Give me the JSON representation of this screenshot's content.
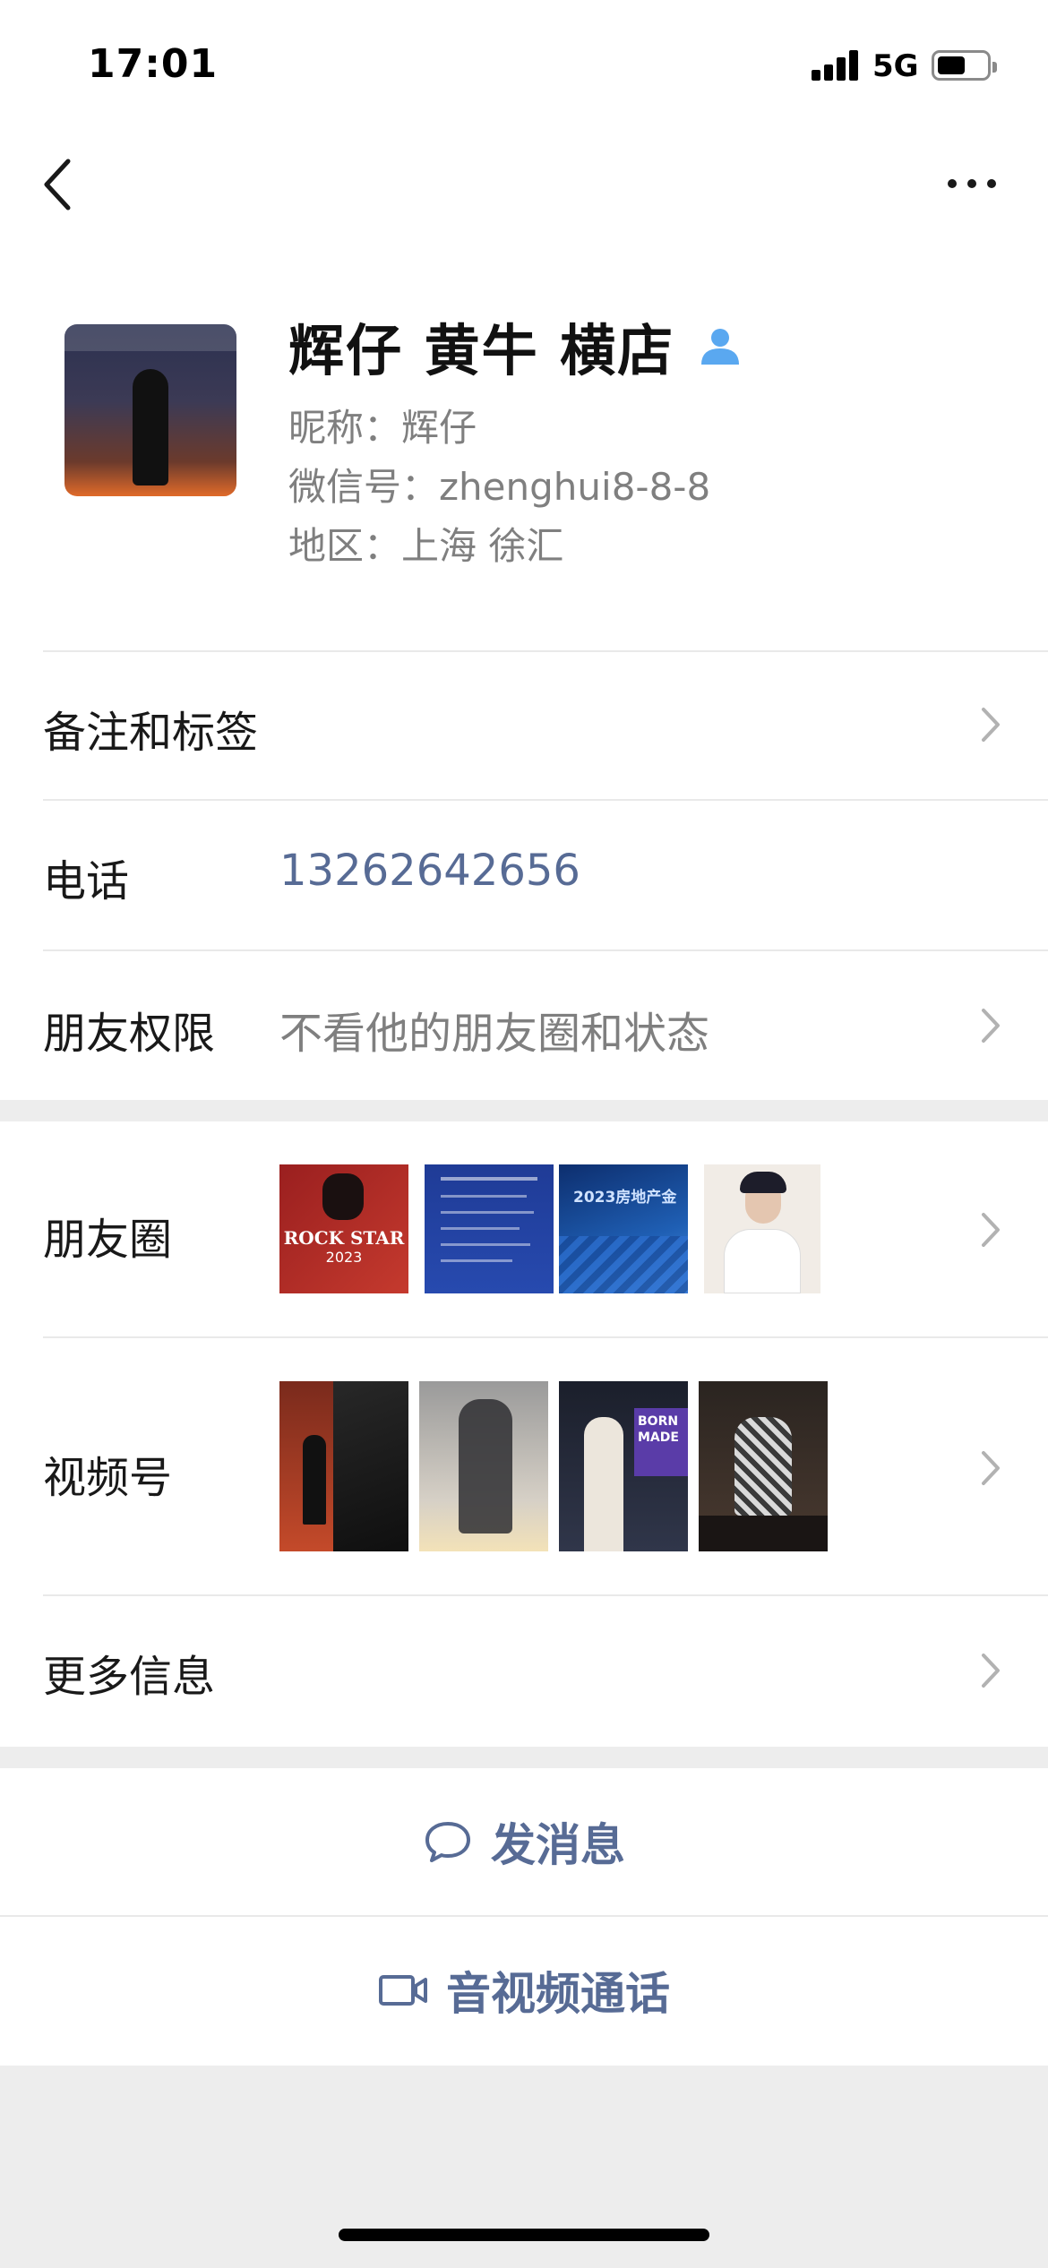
{
  "status_bar": {
    "time": "17:01",
    "network": "5G"
  },
  "profile": {
    "display_name": "辉仔 黄牛 横店",
    "nickname": "昵称：辉仔",
    "wechat_id": "微信号：zhenghui8-8-8",
    "region": "地区：上海 徐汇"
  },
  "rows": {
    "remarks_label": "备注和标签",
    "phone_label": "电话",
    "phone_value": "13262642656",
    "permissions_label": "朋友权限",
    "permissions_value": "不看他的朋友圈和状态",
    "moments_label": "朋友圈",
    "channels_label": "视频号",
    "more_label": "更多信息"
  },
  "moments_thumbs": [
    {
      "icon": "rock-star-poster",
      "text": "ROCK STAR",
      "sub": "2023"
    },
    {
      "icon": "blue-document"
    },
    {
      "icon": "real-estate-banner",
      "text": "2023房地产金"
    },
    {
      "icon": "portrait"
    }
  ],
  "channels_thumbs": [
    {
      "icon": "dark-stage"
    },
    {
      "icon": "backlit-figure"
    },
    {
      "icon": "speaker-on-stage",
      "text": "BORN MADE"
    },
    {
      "icon": "seated-guest"
    }
  ],
  "actions": {
    "message": "发消息",
    "call": "音视频通话"
  },
  "colors": {
    "link": "#576b95",
    "secondary_text": "#7f7f7f",
    "badge": "#5aa8f0",
    "background": "#ededed"
  }
}
